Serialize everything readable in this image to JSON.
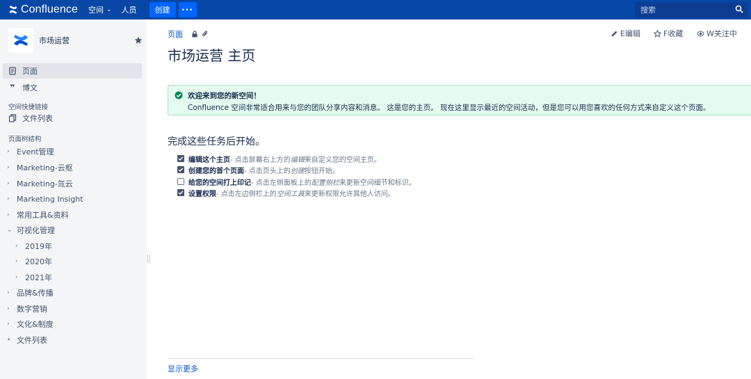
{
  "topbar": {
    "brand": "Confluence",
    "nav": [
      {
        "label": "空间",
        "has_dropdown": true
      },
      {
        "label": "人员",
        "has_dropdown": false
      }
    ],
    "create_label": "创建",
    "more_label": "···",
    "search_placeholder": "搜索"
  },
  "sidebar": {
    "space_name": "市场运营",
    "items": [
      {
        "label": "页面",
        "icon": "page-icon",
        "active": true
      },
      {
        "label": "博文",
        "icon": "quote-icon",
        "active": false
      }
    ],
    "shortcuts_heading": "空间快捷链接",
    "shortcuts": [
      {
        "label": "文件列表",
        "icon": "copy-icon"
      }
    ],
    "tree_heading": "页面树结构",
    "tree": [
      {
        "label": "Event管理",
        "caret": "›",
        "level": 0
      },
      {
        "label": "Marketing-云枢",
        "caret": "›",
        "level": 0
      },
      {
        "label": "Marketing-氚云",
        "caret": "›",
        "level": 0
      },
      {
        "label": "Marketing Insight",
        "caret": "›",
        "level": 0
      },
      {
        "label": "常用工具&资料",
        "caret": "›",
        "level": 0
      },
      {
        "label": "可视化管理",
        "caret": "⌄",
        "level": 0
      },
      {
        "label": "2019年",
        "caret": "›",
        "level": 1
      },
      {
        "label": "2020年",
        "caret": "›",
        "level": 1
      },
      {
        "label": "2021年",
        "caret": "›",
        "level": 1
      },
      {
        "label": "品牌&传播",
        "caret": "›",
        "level": 0
      },
      {
        "label": "数字营销",
        "caret": "›",
        "level": 0
      },
      {
        "label": "文化&制度",
        "caret": "›",
        "level": 0
      },
      {
        "label": "文件列表",
        "caret": "•",
        "level": 0
      }
    ]
  },
  "main": {
    "breadcrumb": "页面",
    "actions": [
      {
        "label": "E编辑",
        "icon": "pencil-icon"
      },
      {
        "label": "F收藏",
        "icon": "star-outline-icon"
      },
      {
        "label": "W关注中",
        "icon": "eye-icon"
      }
    ],
    "title": "市场运营 主页",
    "welcome": {
      "title": "欢迎来到您的新空间！",
      "text": "Confluence 空间非常适合用来与您的团队分享内容和消息。 这是您的主页。 现在这里显示最近的空间活动，但是您可以用您喜欢的任何方式来自定义这个页面。"
    },
    "tasks_heading": "完成这些任务后开始。",
    "tasks": [
      {
        "checked": true,
        "strong": "编辑这个主页",
        "rest": " - 点击屏幕右上方的",
        "em": "编辑",
        "tail": "来自定义您的空间主页。"
      },
      {
        "checked": true,
        "strong": "创建您的首个页面",
        "rest": " - 点击页头上的",
        "em": "创建",
        "tail": "按钮开始。"
      },
      {
        "checked": false,
        "strong": "给您的空间打上印记",
        "rest": " - 点击左侧面板上的",
        "em": "配置侧栏",
        "tail": "来更新空间细节和标识。"
      },
      {
        "checked": true,
        "strong": "设置权限",
        "rest": " - 点击左边侧栏上的",
        "em": "空间工具",
        "tail": "来更新权限允许其他人访问。"
      }
    ],
    "show_more": "显示更多"
  },
  "colors": {
    "topbar": "#0747a6",
    "button": "#0065ff",
    "link": "#0052cc",
    "success_bg": "#e3fcef"
  }
}
